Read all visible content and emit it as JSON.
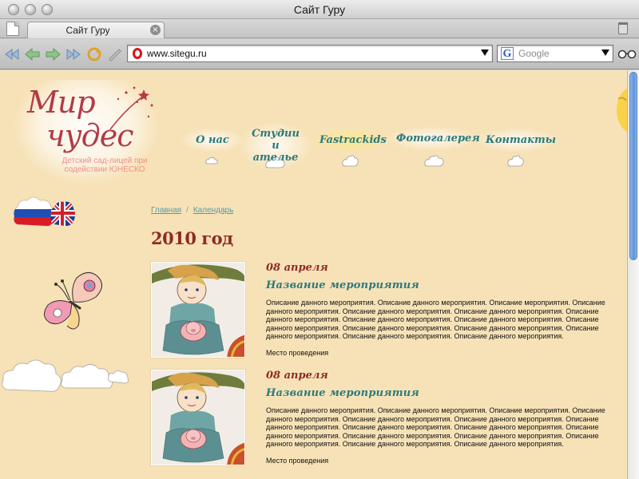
{
  "window": {
    "title": "Сайт Гуру"
  },
  "tabs": [
    {
      "label": "Сайт Гуру"
    }
  ],
  "toolbar": {
    "address": "www.sitegu.ru",
    "search_placeholder": "Google",
    "search_engine_letter": "G"
  },
  "site": {
    "logo_line1": "Мир",
    "logo_line2": "чудес",
    "logo_subtitle": "Детский сад-лицей при содействии ЮНЕСКО",
    "nav": [
      {
        "label": "О нас"
      },
      {
        "label": "Студии и ателье"
      },
      {
        "label": "Fastrackids"
      },
      {
        "label": "Фотогалерея"
      },
      {
        "label": "Контакты"
      }
    ]
  },
  "breadcrumb": [
    {
      "label": "Главная"
    },
    {
      "label": "Календарь"
    }
  ],
  "breadcrumb_sep": "/",
  "page_title": "2010 год",
  "events": [
    {
      "date": "08 апреля",
      "name": "Название мероприятия",
      "description": "Описание данного мероприятия. Описание данного мероприятия. Описание мероприятия. Описание данного мероприятия. Описание данного мероприятия. Описание данного мероприятия. Описание данного мероприятия. Описание данного мероприятия. Описание данного мероприятия. Описание данного мероприятия. Описание данного мероприятия. Описание данного мероприятия. Описание данного мероприятия. Описание данного мероприятия. Описание данного мероприятия.",
      "place": "Место проведения"
    },
    {
      "date": "08 апреля",
      "name": "Название мероприятия",
      "description": "Описание данного мероприятия. Описание данного мероприятия. Описание мероприятия. Описание данного мероприятия. Описание данного мероприятия. Описание данного мероприятия. Описание данного мероприятия. Описание данного мероприятия. Описание данного мероприятия. Описание данного мероприятия. Описание данного мероприятия. Описание данного мероприятия. Описание данного мероприятия. Описание данного мероприятия. Описание данного мероприятия.",
      "place": "Место проведения"
    }
  ],
  "colors": {
    "page_background": "#f7e2b7",
    "brand_red": "#8f2a24",
    "brand_teal": "#2b7a7d",
    "logo_pink": "#ef8e8e"
  }
}
